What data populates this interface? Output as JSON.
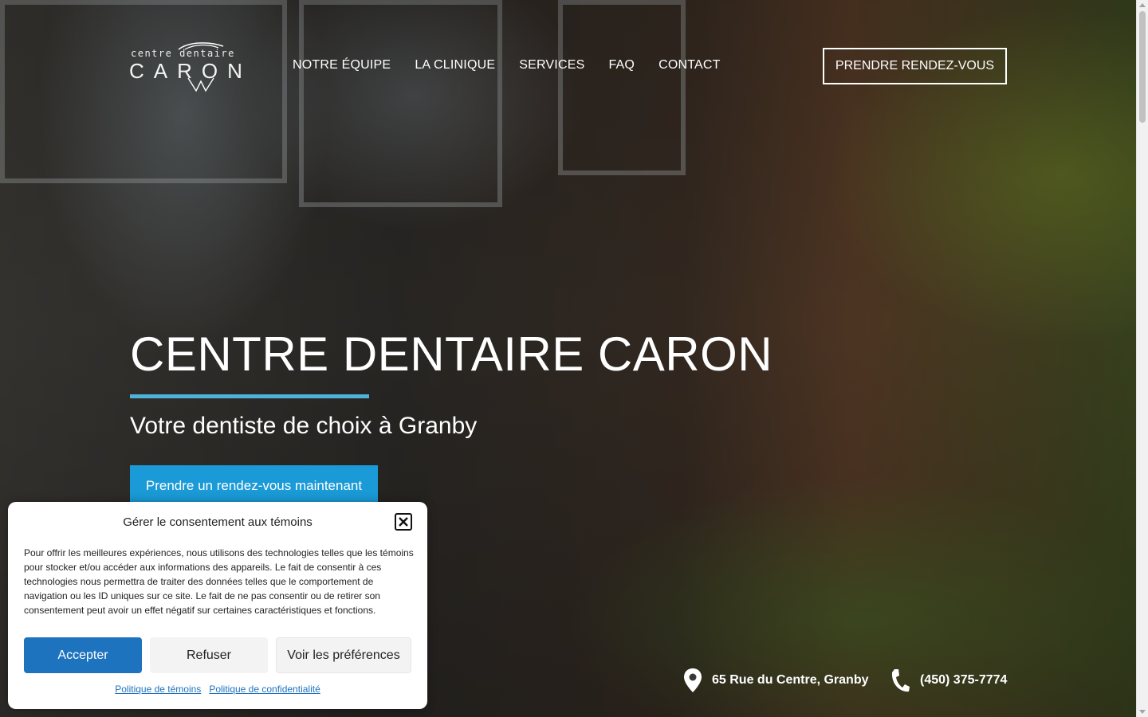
{
  "header": {
    "logo_small": "centre dentaire",
    "logo_main": "CARON",
    "nav": [
      {
        "label": "NOTRE ÉQUIPE"
      },
      {
        "label": "LA CLINIQUE"
      },
      {
        "label": "SERVICES"
      },
      {
        "label": "FAQ"
      },
      {
        "label": "CONTACT"
      }
    ],
    "cta_label": "PRENDRE RENDEZ-VOUS"
  },
  "hero": {
    "title": "CENTRE DENTAIRE CARON",
    "subtitle": "Votre dentiste de choix à Granby",
    "button_label": "Prendre un rendez-vous maintenant",
    "accent_color": "#4fb3d9",
    "button_color": "#1a9ad6"
  },
  "contact": {
    "address": "65 Rue du Centre, Granby",
    "address_icon": "map-pin-icon",
    "phone": "(450) 375-7774",
    "phone_icon": "phone-icon"
  },
  "consent": {
    "title": "Gérer le consentement aux témoins",
    "text": "Pour offrir les meilleures expériences, nous utilisons des technologies telles que les témoins pour stocker et/ou accéder aux informations des appareils. Le fait de consentir à ces technologies nous permettra de traiter des données telles que le comportement de navigation ou les ID uniques sur ce site. Le fait de ne pas consentir ou de retirer son consentement peut avoir un effet négatif sur certaines caractéristiques et fonctions.",
    "accept_label": "Accepter",
    "refuse_label": "Refuser",
    "prefs_label": "Voir les préférences",
    "cookie_policy_link": "Politique de témoins",
    "privacy_policy_link": "Politique de confidentialité",
    "accept_color": "#1e73be"
  }
}
